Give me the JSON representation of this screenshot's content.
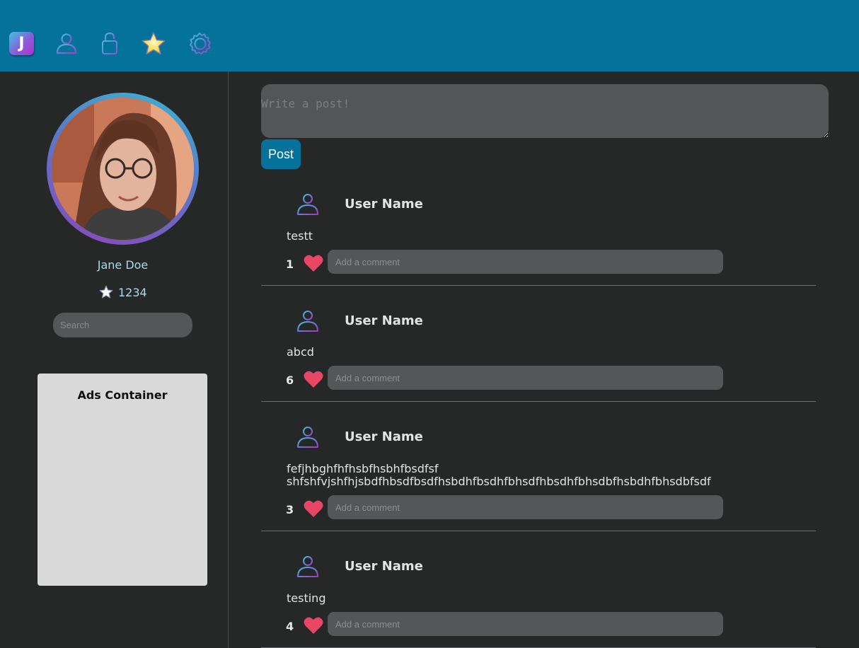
{
  "nav": {
    "logo_letter": "J",
    "items": [
      {
        "icon": "profile-icon"
      },
      {
        "icon": "lock-icon"
      },
      {
        "icon": "star-icon"
      },
      {
        "icon": "gear-icon"
      }
    ]
  },
  "profile": {
    "name": "Jane Doe",
    "points": "1234",
    "search_placeholder": "Search"
  },
  "ads": {
    "title": "Ads Container"
  },
  "composer": {
    "placeholder": "Write a post!",
    "button_label": "Post"
  },
  "comment_placeholder": "Add a comment",
  "posts": [
    {
      "user": "User Name",
      "text": "testt",
      "likes": "1"
    },
    {
      "user": "User Name",
      "text": "abcd",
      "likes": "6"
    },
    {
      "user": "User Name",
      "text": "fefjhbghfhfhsbfhsbhfbsdfsf\nshfshfvjshfhjsbdfhbsdfbsdfhsbdhfbsdhfbhsdfhbsdhfbhsdbfhsbdhfbhsdbfsdf",
      "likes": "3"
    },
    {
      "user": "User Name",
      "text": "testing",
      "likes": "4"
    }
  ],
  "colors": {
    "header": "#05729c",
    "background": "#262727",
    "accent_heart": "#e84665",
    "gradient_start": "#38b6d6",
    "gradient_end": "#8a48b8"
  }
}
